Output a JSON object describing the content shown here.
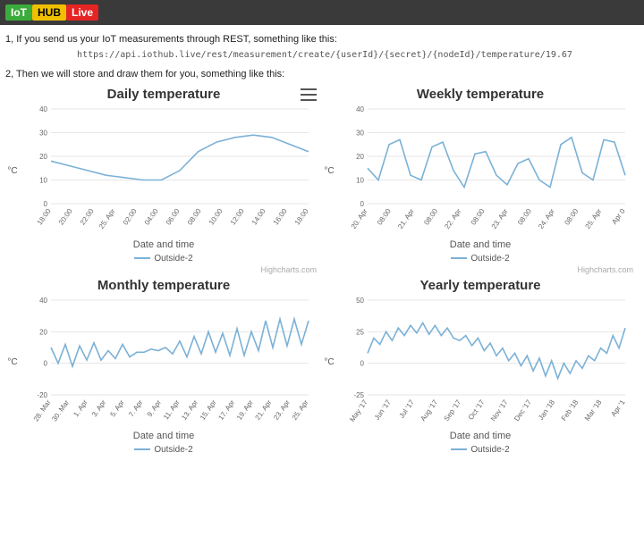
{
  "brand": {
    "p1": "IoT",
    "p2": "HUB",
    "p3": "Live"
  },
  "intro": {
    "line1": "1, If you send us your IoT measurements through REST, something like this:",
    "code": "https://api.iothub.live/rest/measurement/create/{userId}/{secret}/{nodeId}/temperature/19.67",
    "line2": "2, Then we will store and draw them for you, something like this:"
  },
  "common": {
    "ylabel": "°C",
    "xlabel": "Date and time",
    "legend": "Outside-2",
    "credit": "Highcharts.com",
    "menu_icon": "chart-menu-icon",
    "line_color": "#7bb1d6"
  },
  "charts": [
    {
      "id": "daily",
      "title": "Daily temperature",
      "show_menu": true,
      "show_credit": true
    },
    {
      "id": "weekly",
      "title": "Weekly temperature",
      "show_menu": false,
      "show_credit": true
    },
    {
      "id": "monthly",
      "title": "Monthly temperature",
      "show_menu": false,
      "show_credit": false
    },
    {
      "id": "yearly",
      "title": "Yearly temperature",
      "show_menu": false,
      "show_credit": false
    }
  ],
  "chart_data": [
    {
      "id": "daily",
      "type": "line",
      "title": "Daily temperature",
      "xlabel": "Date and time",
      "ylabel": "°C",
      "ylim": [
        0,
        40
      ],
      "yticks": [
        0,
        10,
        20,
        30,
        40
      ],
      "x_labels": [
        "18:00",
        "20:00",
        "22:00",
        "25. Apr",
        "02:00",
        "04:00",
        "06:00",
        "08:00",
        "10:00",
        "12:00",
        "14:00",
        "16:00",
        "18:00"
      ],
      "series": [
        {
          "name": "Outside-2",
          "values": [
            18,
            16,
            14,
            12,
            11,
            10,
            10,
            14,
            22,
            26,
            28,
            29,
            28,
            25,
            22
          ]
        }
      ]
    },
    {
      "id": "weekly",
      "type": "line",
      "title": "Weekly temperature",
      "xlabel": "Date and time",
      "ylabel": "°C",
      "ylim": [
        0,
        40
      ],
      "yticks": [
        0,
        10,
        20,
        30,
        40
      ],
      "x_labels": [
        "20. Apr",
        "08:00",
        "21. Apr",
        "08:00",
        "22. Apr",
        "08:00",
        "23. Apr",
        "08:00",
        "24. Apr",
        "08:00",
        "25. Apr",
        "Apr 0"
      ],
      "series": [
        {
          "name": "Outside-2",
          "values": [
            15,
            10,
            25,
            27,
            12,
            10,
            24,
            26,
            14,
            7,
            21,
            22,
            12,
            8,
            17,
            19,
            10,
            7,
            25,
            28,
            13,
            10,
            27,
            26,
            12
          ]
        }
      ]
    },
    {
      "id": "monthly",
      "type": "line",
      "title": "Monthly temperature",
      "xlabel": "Date and time",
      "ylabel": "°C",
      "ylim": [
        -20,
        40
      ],
      "yticks": [
        -20,
        0,
        20,
        40
      ],
      "x_labels": [
        "28. Mar",
        "30. Mar",
        "1. Apr",
        "3. Apr",
        "5. Apr",
        "7. Apr",
        "9. Apr",
        "11. Apr",
        "13. Apr",
        "15. Apr",
        "17. Apr",
        "19. Apr",
        "21. Apr",
        "23. Apr",
        "25. Apr"
      ],
      "series": [
        {
          "name": "Outside-2",
          "values": [
            10,
            0,
            12,
            -2,
            11,
            2,
            13,
            2,
            8,
            3,
            12,
            4,
            7,
            7,
            9,
            8,
            10,
            6,
            14,
            4,
            17,
            6,
            20,
            7,
            19,
            5,
            22,
            5,
            20,
            8,
            27,
            10,
            28,
            11,
            28,
            12,
            27
          ]
        }
      ]
    },
    {
      "id": "yearly",
      "type": "line",
      "title": "Yearly temperature",
      "xlabel": "Date and time",
      "ylabel": "°C",
      "ylim": [
        -25,
        50
      ],
      "yticks": [
        -25,
        0,
        25,
        50
      ],
      "x_labels": [
        "May '17",
        "Jun '17",
        "Jul '17",
        "Aug '17",
        "Sep '17",
        "Oct '17",
        "Nov '17",
        "Dec '17",
        "Jan '18",
        "Feb '18",
        "Mar '18",
        "Apr '1"
      ],
      "series": [
        {
          "name": "Outside-2",
          "values": [
            8,
            20,
            15,
            25,
            18,
            28,
            22,
            30,
            24,
            32,
            23,
            30,
            22,
            28,
            20,
            18,
            22,
            14,
            20,
            10,
            16,
            6,
            12,
            2,
            8,
            -2,
            6,
            -6,
            4,
            -10,
            2,
            -12,
            0,
            -8,
            2,
            -4,
            6,
            2,
            12,
            8,
            22,
            12,
            28
          ]
        }
      ]
    }
  ]
}
